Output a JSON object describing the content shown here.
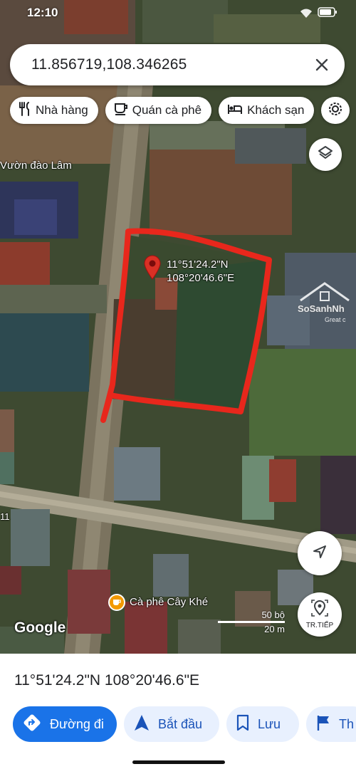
{
  "status_bar": {
    "time": "12:10"
  },
  "search": {
    "value": "11.856719,108.346265"
  },
  "chips": [
    {
      "label": "Nhà hàng",
      "icon": "restaurant-icon"
    },
    {
      "label": "Quán cà phê",
      "icon": "coffee-icon"
    },
    {
      "label": "Khách sạn",
      "icon": "hotel-icon"
    }
  ],
  "map": {
    "place_labels": {
      "garden": "Vườn đào Lâm",
      "cafe": "Cà phê Cây Khé"
    },
    "pin_coords": {
      "lat": "11°51'24.2\"N",
      "lng": "108°20'46.6\"E"
    },
    "attribution": "Google",
    "scale": {
      "feet": "50 bộ",
      "meters": "20 m"
    },
    "next_button_label": "TR.TIẾP",
    "watermark": {
      "name": "SoSanhNh",
      "tagline": "Great c"
    },
    "edge_label": "11",
    "highlight_color": "#e8271c"
  },
  "sheet": {
    "coords": "11°51'24.2\"N 108°20'46.6\"E",
    "actions": [
      {
        "label": "Đường đi",
        "icon": "directions-icon"
      },
      {
        "label": "Bắt đầu",
        "icon": "navigation-arrow-icon"
      },
      {
        "label": "Lưu",
        "icon": "bookmark-icon"
      },
      {
        "label": "Th",
        "icon": "flag-icon"
      }
    ]
  },
  "colors": {
    "accent": "#1a73e8",
    "chip_bg": "#e8f0fe",
    "pin": "#d93025"
  }
}
